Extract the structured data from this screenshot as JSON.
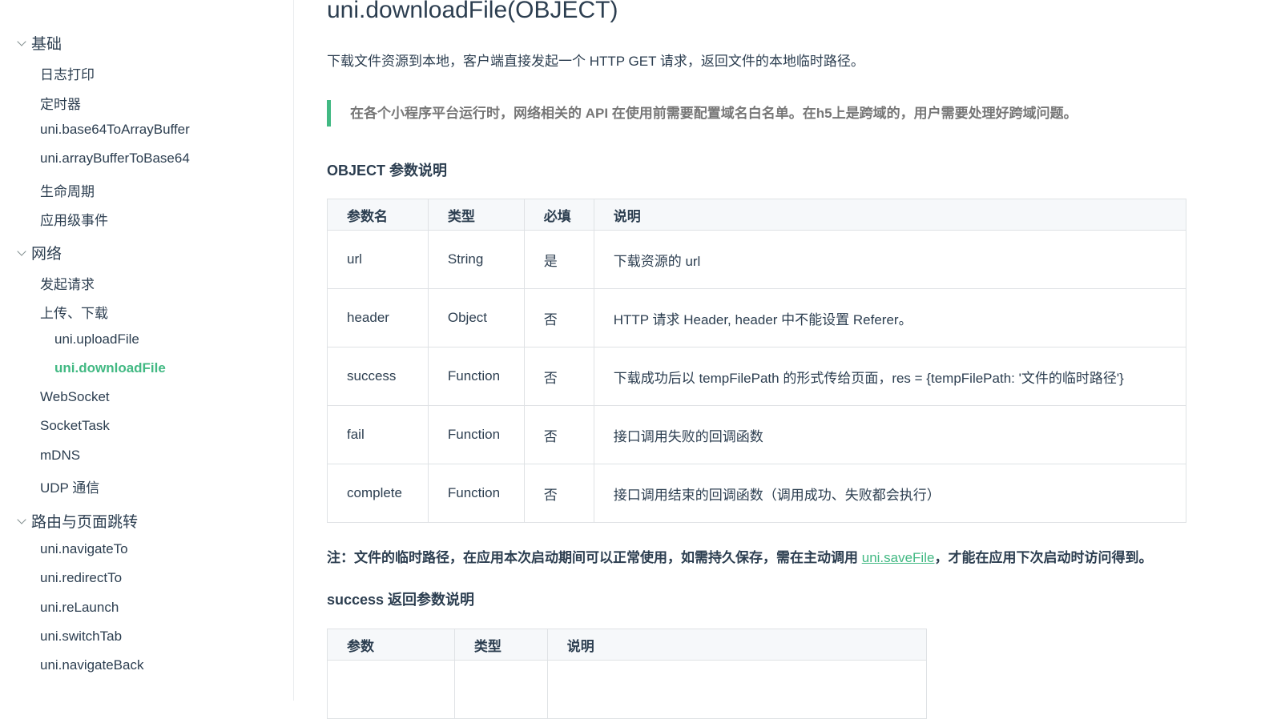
{
  "sidebar": {
    "groups": [
      {
        "label": "基础",
        "items": [
          "日志打印",
          "定时器",
          "uni.base64ToArrayBuffer",
          "uni.arrayBufferToBase64",
          "生命周期",
          "应用级事件"
        ]
      },
      {
        "label": "网络",
        "items": [
          "发起请求",
          "上传、下载",
          "uni.uploadFile",
          "uni.downloadFile",
          "WebSocket",
          "SocketTask",
          "mDNS",
          "UDP 通信"
        ]
      },
      {
        "label": "路由与页面跳转",
        "items": [
          "uni.navigateTo",
          "uni.redirectTo",
          "uni.reLaunch",
          "uni.switchTab",
          "uni.navigateBack"
        ]
      }
    ]
  },
  "main": {
    "title": "uni.downloadFile(OBJECT)",
    "description": "下载文件资源到本地，客户端直接发起一个 HTTP GET 请求，返回文件的本地临时路径。",
    "tip": "在各个小程序平台运行时，网络相关的 API 在使用前需要配置域名白名单。在h5上是跨域的，用户需要处理好跨域问题。",
    "object_section_title": "OBJECT 参数说明",
    "object_table": {
      "headers": [
        "参数名",
        "类型",
        "必填",
        "说明"
      ],
      "rows": [
        [
          "url",
          "String",
          "是",
          "下载资源的 url"
        ],
        [
          "header",
          "Object",
          "否",
          "HTTP 请求 Header, header 中不能设置 Referer。"
        ],
        [
          "success",
          "Function",
          "否",
          "下载成功后以 tempFilePath 的形式传给页面，res = {tempFilePath: '文件的临时路径'}"
        ],
        [
          "fail",
          "Function",
          "否",
          "接口调用失败的回调函数"
        ],
        [
          "complete",
          "Function",
          "否",
          "接口调用结束的回调函数（调用成功、失败都会执行）"
        ]
      ]
    },
    "note_before": "注：文件的临时路径，在应用本次启动期间可以正常使用，如需持久保存，需在主动调用 ",
    "note_link": "uni.saveFile",
    "note_after": "，才能在应用下次启动时访问得到。",
    "success_section_title": "success 返回参数说明",
    "success_table": {
      "headers": [
        "参数",
        "类型",
        "说明"
      ]
    }
  }
}
